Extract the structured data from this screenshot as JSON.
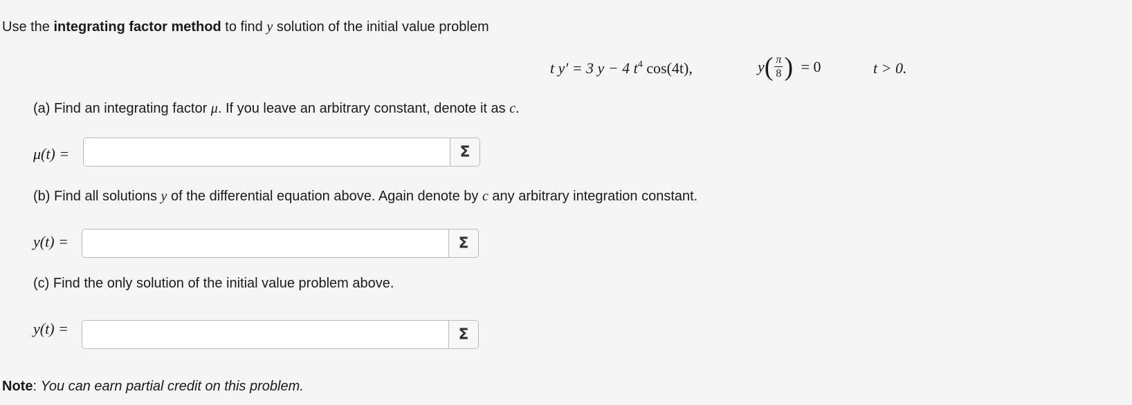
{
  "intro": {
    "prefix": "Use the ",
    "bold": "integrating factor method",
    "mid": " to find ",
    "var": "y",
    "suffix": " solution of the initial value problem"
  },
  "equation": {
    "main_lhs": "t y′ = 3 y − 4 t",
    "main_exp": "4",
    "main_rhs": " cos(4t),",
    "ic_fn": "y",
    "ic_num": "π",
    "ic_den": "8",
    "ic_rhs": "= 0",
    "condition": "t > 0."
  },
  "part_a": {
    "q_prefix": "(a) Find an integrating factor ",
    "q_var": "μ",
    "q_mid": ". If you leave an arbitrary constant, denote it as ",
    "q_const": "c",
    "q_end": ".",
    "label": "μ(t) =",
    "value": "",
    "sigma": "Σ"
  },
  "part_b": {
    "q_prefix": "(b) Find all solutions ",
    "q_var": "y",
    "q_mid": " of the differential equation above. Again denote by ",
    "q_const": "c",
    "q_end": " any arbitrary integration constant.",
    "label": "y(t) =",
    "value": "",
    "sigma": "Σ"
  },
  "part_c": {
    "question": "(c) Find the only solution of the initial value problem above.",
    "label": "y(t) =",
    "value": "",
    "sigma": "Σ"
  },
  "note": {
    "bold": "Note",
    "rest": ": ",
    "italic": "You can earn partial credit on this problem."
  }
}
